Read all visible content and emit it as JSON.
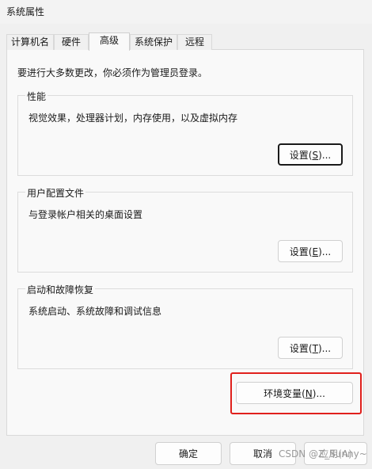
{
  "window": {
    "title": "系统属性"
  },
  "tabs": [
    {
      "label": "计算机名"
    },
    {
      "label": "硬件"
    },
    {
      "label": "高级"
    },
    {
      "label": "系统保护"
    },
    {
      "label": "远程"
    }
  ],
  "notice": "要进行大多数更改，你必须作为管理员登录。",
  "performance": {
    "title": "性能",
    "description": "视觉效果，处理器计划，内存使用，以及虚拟内存",
    "button": {
      "text": "设置(",
      "mnemonic": "S",
      "suffix": ")..."
    }
  },
  "user_profiles": {
    "title": "用户配置文件",
    "description": "与登录帐户相关的桌面设置",
    "button": {
      "text": "设置(",
      "mnemonic": "E",
      "suffix": ")..."
    }
  },
  "startup_recovery": {
    "title": "启动和故障恢复",
    "description": "系统启动、系统故障和调试信息",
    "button": {
      "text": "设置(",
      "mnemonic": "T",
      "suffix": ")..."
    }
  },
  "env_button": {
    "text": "环境变量(",
    "mnemonic": "N",
    "suffix": ")..."
  },
  "footer": {
    "ok": "确定",
    "cancel": "取消",
    "apply": "应用(A)"
  },
  "watermark": "CSDN @Z_Sunny~",
  "colors": {
    "highlight": "#e0201c",
    "panel": "#f9f9f9",
    "window": "#f0f0f0"
  }
}
